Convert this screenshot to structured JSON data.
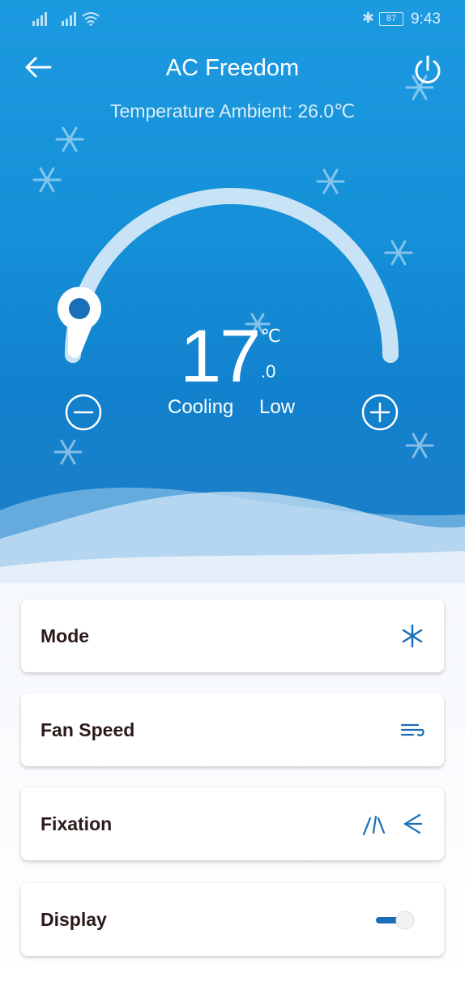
{
  "status_bar": {
    "battery": "87",
    "time": "9:43"
  },
  "header": {
    "title": "AC Freedom"
  },
  "ambient": {
    "text": "Temperature Ambient: 26.0℃"
  },
  "thermostat": {
    "temperature": "17",
    "unit": "℃",
    "decimal": ".0",
    "mode": "Cooling",
    "fan": "Low"
  },
  "controls": [
    {
      "label": "Mode",
      "icon": "snowflake-icon"
    },
    {
      "label": "Fan Speed",
      "icon": "wind-icon"
    },
    {
      "label": "Fixation",
      "icons": [
        "vertical-swing-icon",
        "horizontal-swing-icon"
      ]
    },
    {
      "label": "Display",
      "toggle_on": true
    }
  ],
  "colors": {
    "accent": "#1a6fb8",
    "hero_top": "#1c9ae0",
    "hero_bottom": "#1280cc"
  }
}
